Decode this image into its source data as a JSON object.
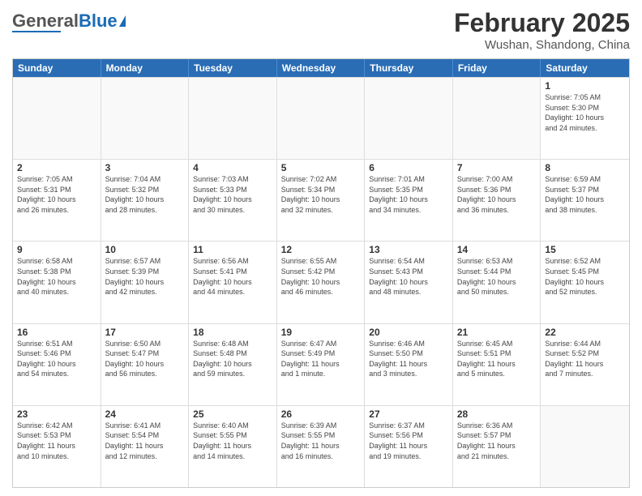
{
  "header": {
    "logo_general": "General",
    "logo_blue": "Blue",
    "month_title": "February 2025",
    "location": "Wushan, Shandong, China"
  },
  "weekdays": [
    "Sunday",
    "Monday",
    "Tuesday",
    "Wednesday",
    "Thursday",
    "Friday",
    "Saturday"
  ],
  "weeks": [
    [
      {
        "day": "",
        "info": ""
      },
      {
        "day": "",
        "info": ""
      },
      {
        "day": "",
        "info": ""
      },
      {
        "day": "",
        "info": ""
      },
      {
        "day": "",
        "info": ""
      },
      {
        "day": "",
        "info": ""
      },
      {
        "day": "1",
        "info": "Sunrise: 7:05 AM\nSunset: 5:30 PM\nDaylight: 10 hours\nand 24 minutes."
      }
    ],
    [
      {
        "day": "2",
        "info": "Sunrise: 7:05 AM\nSunset: 5:31 PM\nDaylight: 10 hours\nand 26 minutes."
      },
      {
        "day": "3",
        "info": "Sunrise: 7:04 AM\nSunset: 5:32 PM\nDaylight: 10 hours\nand 28 minutes."
      },
      {
        "day": "4",
        "info": "Sunrise: 7:03 AM\nSunset: 5:33 PM\nDaylight: 10 hours\nand 30 minutes."
      },
      {
        "day": "5",
        "info": "Sunrise: 7:02 AM\nSunset: 5:34 PM\nDaylight: 10 hours\nand 32 minutes."
      },
      {
        "day": "6",
        "info": "Sunrise: 7:01 AM\nSunset: 5:35 PM\nDaylight: 10 hours\nand 34 minutes."
      },
      {
        "day": "7",
        "info": "Sunrise: 7:00 AM\nSunset: 5:36 PM\nDaylight: 10 hours\nand 36 minutes."
      },
      {
        "day": "8",
        "info": "Sunrise: 6:59 AM\nSunset: 5:37 PM\nDaylight: 10 hours\nand 38 minutes."
      }
    ],
    [
      {
        "day": "9",
        "info": "Sunrise: 6:58 AM\nSunset: 5:38 PM\nDaylight: 10 hours\nand 40 minutes."
      },
      {
        "day": "10",
        "info": "Sunrise: 6:57 AM\nSunset: 5:39 PM\nDaylight: 10 hours\nand 42 minutes."
      },
      {
        "day": "11",
        "info": "Sunrise: 6:56 AM\nSunset: 5:41 PM\nDaylight: 10 hours\nand 44 minutes."
      },
      {
        "day": "12",
        "info": "Sunrise: 6:55 AM\nSunset: 5:42 PM\nDaylight: 10 hours\nand 46 minutes."
      },
      {
        "day": "13",
        "info": "Sunrise: 6:54 AM\nSunset: 5:43 PM\nDaylight: 10 hours\nand 48 minutes."
      },
      {
        "day": "14",
        "info": "Sunrise: 6:53 AM\nSunset: 5:44 PM\nDaylight: 10 hours\nand 50 minutes."
      },
      {
        "day": "15",
        "info": "Sunrise: 6:52 AM\nSunset: 5:45 PM\nDaylight: 10 hours\nand 52 minutes."
      }
    ],
    [
      {
        "day": "16",
        "info": "Sunrise: 6:51 AM\nSunset: 5:46 PM\nDaylight: 10 hours\nand 54 minutes."
      },
      {
        "day": "17",
        "info": "Sunrise: 6:50 AM\nSunset: 5:47 PM\nDaylight: 10 hours\nand 56 minutes."
      },
      {
        "day": "18",
        "info": "Sunrise: 6:48 AM\nSunset: 5:48 PM\nDaylight: 10 hours\nand 59 minutes."
      },
      {
        "day": "19",
        "info": "Sunrise: 6:47 AM\nSunset: 5:49 PM\nDaylight: 11 hours\nand 1 minute."
      },
      {
        "day": "20",
        "info": "Sunrise: 6:46 AM\nSunset: 5:50 PM\nDaylight: 11 hours\nand 3 minutes."
      },
      {
        "day": "21",
        "info": "Sunrise: 6:45 AM\nSunset: 5:51 PM\nDaylight: 11 hours\nand 5 minutes."
      },
      {
        "day": "22",
        "info": "Sunrise: 6:44 AM\nSunset: 5:52 PM\nDaylight: 11 hours\nand 7 minutes."
      }
    ],
    [
      {
        "day": "23",
        "info": "Sunrise: 6:42 AM\nSunset: 5:53 PM\nDaylight: 11 hours\nand 10 minutes."
      },
      {
        "day": "24",
        "info": "Sunrise: 6:41 AM\nSunset: 5:54 PM\nDaylight: 11 hours\nand 12 minutes."
      },
      {
        "day": "25",
        "info": "Sunrise: 6:40 AM\nSunset: 5:55 PM\nDaylight: 11 hours\nand 14 minutes."
      },
      {
        "day": "26",
        "info": "Sunrise: 6:39 AM\nSunset: 5:55 PM\nDaylight: 11 hours\nand 16 minutes."
      },
      {
        "day": "27",
        "info": "Sunrise: 6:37 AM\nSunset: 5:56 PM\nDaylight: 11 hours\nand 19 minutes."
      },
      {
        "day": "28",
        "info": "Sunrise: 6:36 AM\nSunset: 5:57 PM\nDaylight: 11 hours\nand 21 minutes."
      },
      {
        "day": "",
        "info": ""
      }
    ]
  ]
}
